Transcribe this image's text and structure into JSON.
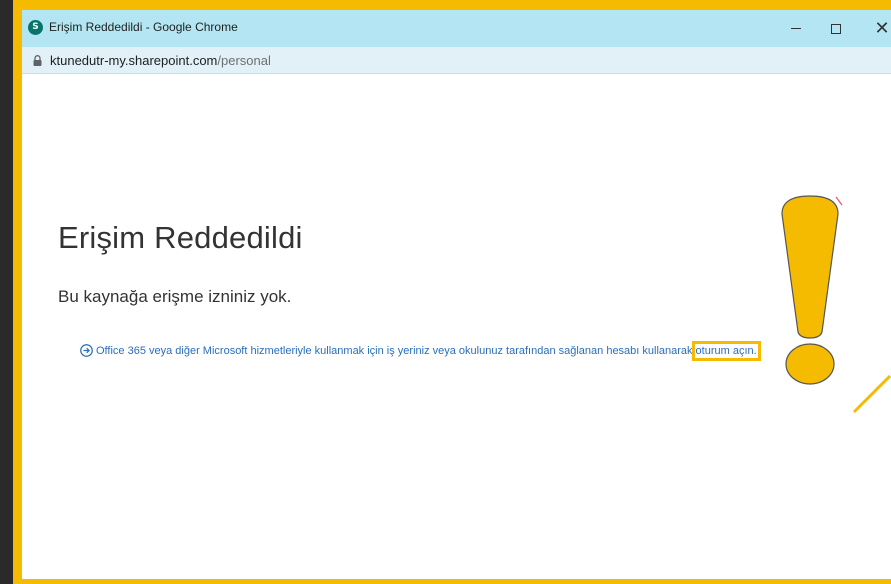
{
  "window": {
    "title": "Erişim Reddedildi - Google Chrome",
    "app_icon_letter": "S",
    "app_icon_name": "sharepoint-icon",
    "controls": {
      "minimize": "minimize-icon",
      "maximize": "maximize-icon",
      "close": "close-icon",
      "close_glyph": "✕"
    }
  },
  "address_bar": {
    "host": "ktunedutr-my.sharepoint.com",
    "path": "/personal",
    "lock_icon": "lock-icon"
  },
  "page": {
    "heading": "Erişim Reddedildi",
    "message": "Bu kaynağa erişme izniniz yok.",
    "signin_text": "Office 365 veya diğer Microsoft hizmetleriyle kullanmak için iş yeriniz veya okulunuz tarafından sağlanan hesabı kullanarak",
    "signin_link": "oturum açın.",
    "signin_icon": "arrow-right-circle-icon"
  },
  "annotation": {
    "icon": "exclamation-mark-icon",
    "highlight_color": "#f5bb00"
  },
  "colors": {
    "titlebar": "#b3e6f2",
    "addressbar": "#e1f1f7",
    "link": "#2a6ebb",
    "frame": "#f5bb00",
    "text": "#333333"
  }
}
